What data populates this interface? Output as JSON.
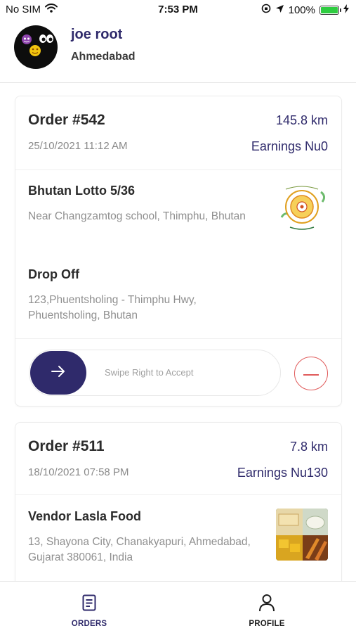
{
  "status_bar": {
    "carrier": "No SIM",
    "time": "7:53 PM",
    "battery_text": "100%",
    "battery_level": 1.0,
    "battery_color": "#2ecc40"
  },
  "user": {
    "name": "joe root",
    "city": "Ahmedabad"
  },
  "orders": [
    {
      "number": "Order #542",
      "distance": "145.8 km",
      "date": "25/10/2021 11:12 AM",
      "earnings": "Earnings Nu0",
      "vendor": {
        "name": "Bhutan Lotto 5/36",
        "address": "Near Changzamtog school, Thimphu, Bhutan",
        "logo_icon": "lotto-seal-logo"
      },
      "dropoff": {
        "title": "Drop Off",
        "address": "123,Phuentsholing - Thimphu Hwy, Phuentsholing, Bhutan"
      },
      "swipe_label": "Swipe Right to Accept"
    },
    {
      "number": "Order #511",
      "distance": "7.8 km",
      "date": "18/10/2021 07:58 PM",
      "earnings": "Earnings Nu130",
      "vendor": {
        "name": "Vendor Lasla Food",
        "address": "13, Shayona City, Chanakyapuri, Ahmedabad, Gujarat 380061, India",
        "logo_icon": "food-platter-image"
      }
    }
  ],
  "nav": {
    "orders_label": "ORDERS",
    "profile_label": "PROFILE",
    "active": "orders"
  },
  "colors": {
    "brand": "#2f2a6b",
    "reject": "#e05a5a",
    "muted_text": "#8f8f8f"
  }
}
